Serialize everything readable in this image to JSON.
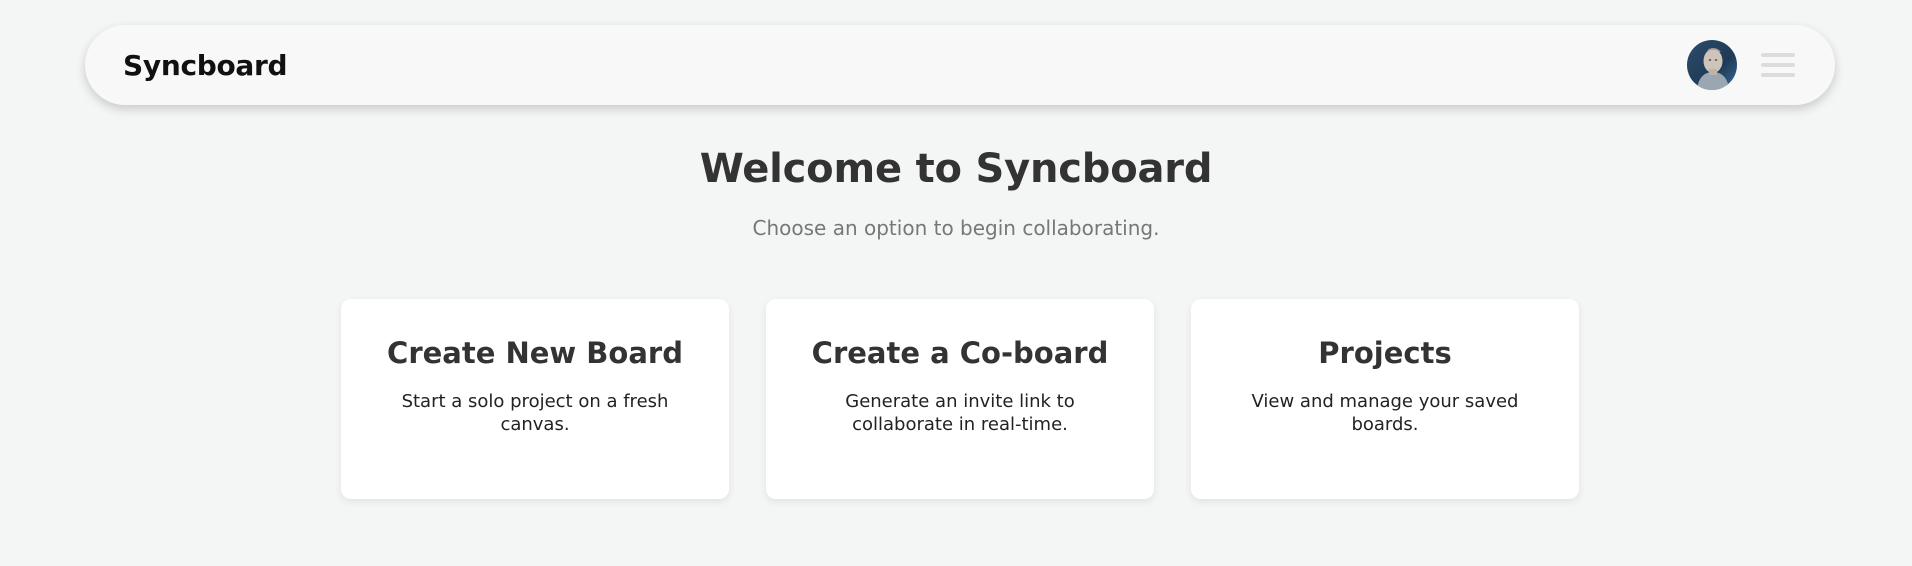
{
  "app": {
    "brand": "Syncboard"
  },
  "header": {
    "avatar_icon": "user-avatar",
    "menu_icon": "hamburger-menu-icon"
  },
  "hero": {
    "title": "Welcome to Syncboard",
    "subtitle": "Choose an option to begin collaborating."
  },
  "cards": [
    {
      "title": "Create New Board",
      "description": "Start a solo project on a fresh canvas."
    },
    {
      "title": "Create a Co-board",
      "description": "Generate an invite link to collaborate in real-time."
    },
    {
      "title": "Projects",
      "description": "View and manage your saved boards."
    }
  ],
  "colors": {
    "background": "#f4f6f5",
    "navbar": "#f7f8f7",
    "card": "#ffffff",
    "text_primary": "#333333",
    "text_muted": "#777777"
  }
}
